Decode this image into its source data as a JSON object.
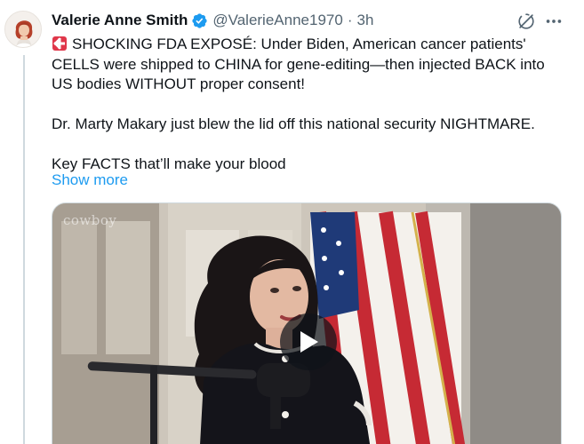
{
  "post": {
    "author_name": "Valerie Anne Smith",
    "handle": "@ValerieAnne1970",
    "separator": "·",
    "time": "3h",
    "text_line1": "SHOCKING FDA EXPOSÉ: Under Biden, American cancer patients'",
    "text_line2": "CELLS were shipped to CHINA for gene-editing—then injected BACK into",
    "text_line3": "US bodies WITHOUT proper consent!",
    "text_line4": "Dr. Marty Makary just blew the lid off this national security NIGHTMARE.",
    "text_line5": "Key FACTS that’ll make your blood",
    "show_more": "Show more"
  },
  "media": {
    "watermark": "cowboy"
  },
  "icons": {
    "verified": "verified-badge-icon",
    "grok": "grok-icon",
    "more": "more-options-icon",
    "siren": "siren-emoji-icon",
    "play": "play-icon"
  },
  "colors": {
    "accent": "#1d9bf0",
    "text": "#0f1419",
    "muted": "#536471",
    "thread_line": "#cfd9de"
  }
}
